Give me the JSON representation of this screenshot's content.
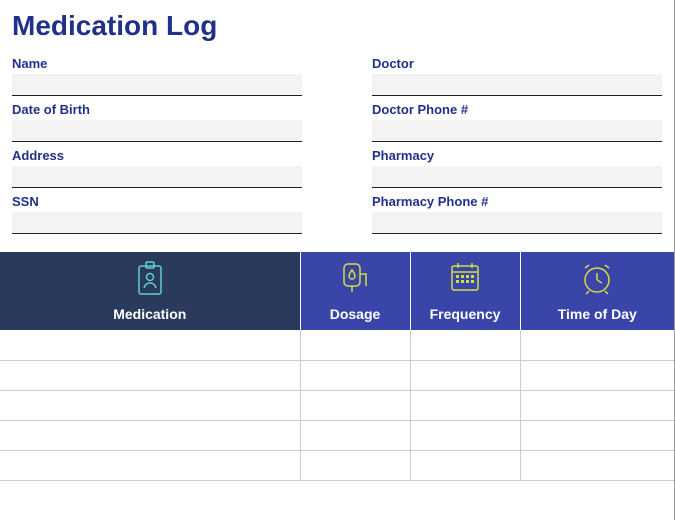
{
  "title": "Medication Log",
  "fields": {
    "left": [
      {
        "label": "Name",
        "value": ""
      },
      {
        "label": "Date of Birth",
        "value": ""
      },
      {
        "label": "Address",
        "value": ""
      },
      {
        "label": "SSN",
        "value": ""
      }
    ],
    "right": [
      {
        "label": "Doctor",
        "value": ""
      },
      {
        "label": "Doctor Phone #",
        "value": ""
      },
      {
        "label": "Pharmacy",
        "value": ""
      },
      {
        "label": "Pharmacy Phone #",
        "value": ""
      }
    ]
  },
  "columns": {
    "medication": "Medication",
    "dosage": "Dosage",
    "frequency": "Frequency",
    "time_of_day": "Time of Day"
  },
  "rows": [
    {
      "medication": "",
      "dosage": "",
      "frequency": "",
      "time_of_day": ""
    },
    {
      "medication": "",
      "dosage": "",
      "frequency": "",
      "time_of_day": ""
    },
    {
      "medication": "",
      "dosage": "",
      "frequency": "",
      "time_of_day": ""
    },
    {
      "medication": "",
      "dosage": "",
      "frequency": "",
      "time_of_day": ""
    },
    {
      "medication": "",
      "dosage": "",
      "frequency": "",
      "time_of_day": ""
    }
  ],
  "colors": {
    "brand": "#21318a",
    "header_dark": "#293a5c",
    "header_blue": "#3a45a9",
    "icon_cyan": "#5fd0c8",
    "icon_yellow": "#d5dd3a"
  }
}
